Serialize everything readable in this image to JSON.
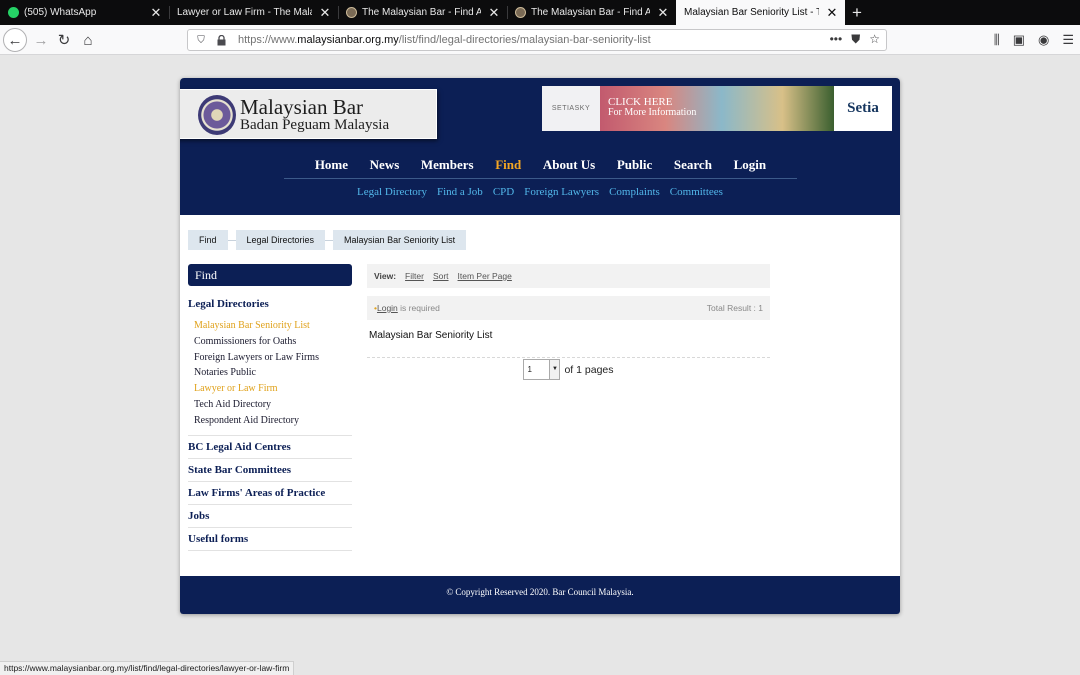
{
  "browser": {
    "tabs": [
      {
        "title": "(505) WhatsApp",
        "favicon": "whatsapp-icon",
        "active": false
      },
      {
        "title": "Lawyer or Law Firm - The Malaysian",
        "favicon": "none",
        "active": false
      },
      {
        "title": "The Malaysian Bar - Find A Law",
        "favicon": "malaysian-bar-icon",
        "active": false
      },
      {
        "title": "The Malaysian Bar - Find A Law",
        "favicon": "malaysian-bar-icon",
        "active": false
      },
      {
        "title": "Malaysian Bar Seniority List - The M",
        "favicon": "none",
        "active": true
      }
    ],
    "url_prefix": "https://www.",
    "url_domain": "malaysianbar.org.my",
    "url_path": "/list/find/legal-directories/malaysian-bar-seniority-list",
    "status_url": "https://www.malaysianbar.org.my/list/find/legal-directories/lawyer-or-law-firm"
  },
  "site": {
    "logo_line1": "Malaysian Bar",
    "logo_line2": "Badan Peguam Malaysia",
    "banner": {
      "left": "SETIASKY",
      "cta1": "CLICK HERE",
      "cta2": "For More Information",
      "brand": "Setia"
    },
    "main_nav": [
      "Home",
      "News",
      "Members",
      "Find",
      "About Us",
      "Public",
      "Search",
      "Login"
    ],
    "main_nav_active": "Find",
    "sub_nav": [
      "Legal Directory",
      "Find a Job",
      "CPD",
      "Foreign Lawyers",
      "Complaints",
      "Committees"
    ],
    "breadcrumb": [
      "Find",
      "Legal Directories",
      "Malaysian Bar Seniority List"
    ],
    "sidebar": {
      "header": "Find",
      "section": "Legal Directories",
      "items": [
        {
          "label": "Malaysian Bar Seniority List",
          "highlight": true
        },
        {
          "label": "Commissioners for Oaths",
          "highlight": false
        },
        {
          "label": "Foreign Lawyers or Law Firms",
          "highlight": false
        },
        {
          "label": "Notaries Public",
          "highlight": false
        },
        {
          "label": "Lawyer or Law Firm",
          "highlight": true
        },
        {
          "label": "Tech Aid Directory",
          "highlight": false
        },
        {
          "label": "Respondent Aid Directory",
          "highlight": false
        }
      ],
      "categories": [
        "BC Legal Aid Centres",
        "State Bar Committees",
        "Law Firms' Areas of Practice",
        "Jobs",
        "Useful forms"
      ]
    },
    "content": {
      "view_label": "View:",
      "view_options": [
        "Filter",
        "Sort",
        "Item Per Page"
      ],
      "login_link": "Login",
      "login_text": "is required",
      "total_result": "Total Result : 1",
      "list_title": "Malaysian Bar Seniority List",
      "page_select_value": "1",
      "of_pages": "of 1 pages"
    },
    "footer": "© Copyright Reserved 2020. Bar Council Malaysia."
  },
  "colors": {
    "navy": "#0c1f55",
    "nav_active": "#f5a623",
    "sub_link": "#52b7ea",
    "highlight": "#e0a21c"
  }
}
